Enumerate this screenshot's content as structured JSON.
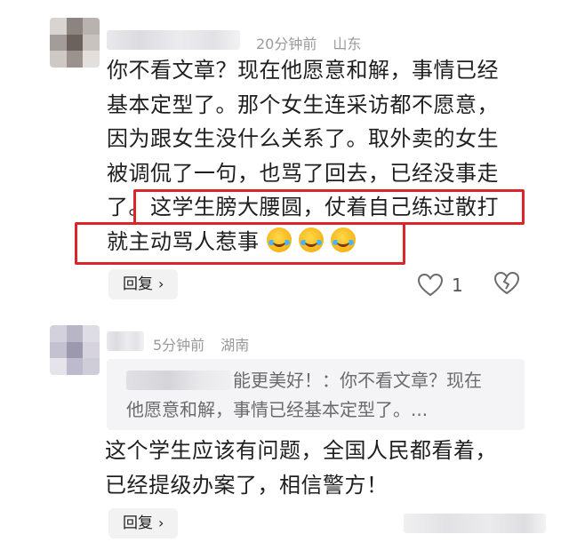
{
  "comments": [
    {
      "time": "20分钟前",
      "region": "山东",
      "lines": [
        "你不看文章？现在他愿意和解，事情已经",
        "基本定型了。那个女生连采访都不愿意，",
        "因为跟女生没什么关系了。取外卖的女生",
        "被调侃了一句，也骂了回去，已经没事走",
        "了。这学生膀大腰圆，仗着自己练过散打",
        "就主动骂人惹事"
      ],
      "line5_prefix": "了。",
      "line5_highlight": "这学生膀大腰圆，仗着自己练过散打",
      "emoji_count": 3,
      "emoji_icon": "laughing-crying-emoji",
      "highlight_color": "#d9252b",
      "reply_label": "回复",
      "like_count": "1"
    },
    {
      "time": "5分钟前",
      "region": "湖南",
      "quote_lines": [
        "能更美好！：你不看文章？现在",
        "他愿意和解，事情已经基本定型了。..."
      ],
      "lines": [
        "这个学生应该有问题，全国人民都看着，",
        "已经提级办案了，相信警方！"
      ],
      "reply_label": "回复"
    }
  ]
}
